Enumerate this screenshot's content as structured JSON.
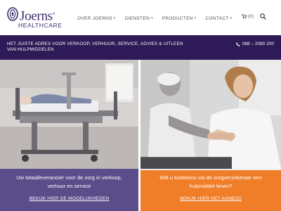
{
  "header": {
    "logo": {
      "name": "Joerns",
      "registered": "®",
      "sub": "HEALTHCARE"
    },
    "nav": [
      {
        "label": "OVER JOERNS",
        "has_dropdown": true
      },
      {
        "label": "DIENSTEN",
        "has_dropdown": true
      },
      {
        "label": "PRODUCTEN",
        "has_dropdown": true
      },
      {
        "label": "CONTACT",
        "has_dropdown": true
      }
    ],
    "cart": {
      "count": "(0)",
      "icon": "cart-icon"
    },
    "search": {
      "icon": "search-icon"
    }
  },
  "topbar": {
    "text": "HET JUISTE ADRES VOOR VERKOOP, VERHUUR, SERVICE, ADVIES & UITLEEN VAN HULPMIDDELEN",
    "phone": "088 – 2080 200",
    "phone_icon": "phone-icon"
  },
  "panels": {
    "left": {
      "title": "Uw totaalleverancier voor de zorg in verkoop, verhuur en service",
      "link": "BEKIJK HIER DE MOGELIJKHEDEN",
      "color": "#5b4c8a"
    },
    "right": {
      "title": "Wilt u kosteloos via de zorgverzekeraar een hulpmiddel lenen?",
      "link": "BEKIJK HIER HET AANBOD",
      "color": "#f07d28"
    }
  },
  "colors": {
    "brand_purple": "#2d1a56",
    "accent_orange": "#f07d28"
  }
}
